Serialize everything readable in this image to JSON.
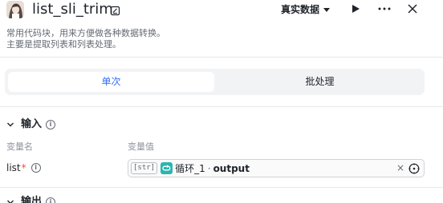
{
  "header": {
    "node_title": "list_sli_trim",
    "data_mode_label": "真实数据",
    "icons": {
      "avatar": "avatar-image",
      "edit": "edit-icon",
      "run": "play-icon",
      "more": "more-icon",
      "close": "close-icon"
    }
  },
  "description": {
    "line1": "常用代码块，用来方便做各种数据转换。",
    "line2": "主要是提取列表和列表处理。"
  },
  "mode_tabs": {
    "single_label": "单次",
    "batch_label": "批处理",
    "active": "single"
  },
  "input_section": {
    "title": "输入",
    "col_name": "变量名",
    "col_value": "变量值",
    "params": [
      {
        "name": "list",
        "required_mark": "*",
        "type_tag": "[str]",
        "ref_node": "循环_1",
        "ref_separator": "·",
        "ref_field": "output",
        "clear_symbol": "×"
      }
    ]
  },
  "output_section": {
    "title": "输出"
  },
  "colors": {
    "accent": "#3370ff",
    "loop_icon": "#2bb5ae",
    "required": "#f54a45"
  }
}
